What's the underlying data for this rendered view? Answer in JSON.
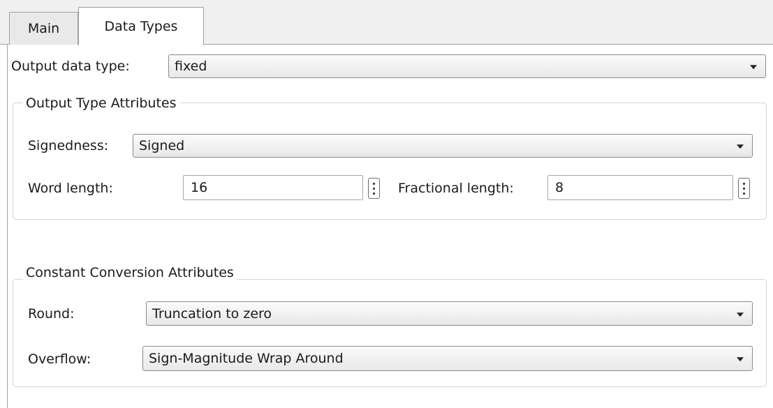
{
  "tabs": [
    {
      "label": "Main",
      "active": false
    },
    {
      "label": "Data Types",
      "active": true
    }
  ],
  "output_data_type": {
    "label": "Output data type:",
    "value": "fixed"
  },
  "output_type_attributes": {
    "title": "Output Type Attributes",
    "signedness": {
      "label": "Signedness:",
      "value": "Signed"
    },
    "word_length": {
      "label": "Word length:",
      "value": "16"
    },
    "fractional_length": {
      "label": "Fractional length:",
      "value": "8"
    }
  },
  "constant_conversion_attributes": {
    "title": "Constant Conversion Attributes",
    "round": {
      "label": "Round:",
      "value": "Truncation to zero"
    },
    "overflow": {
      "label": "Overflow:",
      "value": "Sign-Magnitude Wrap Around"
    }
  },
  "icons": {
    "dropdown_arrow": "chevron-down-icon",
    "spinner": "vertical-ellipsis-icon"
  },
  "colors": {
    "tab_active_bg": "#ffffff",
    "tab_inactive_bg": "#e9e9e9",
    "group_border": "#d4d4d4",
    "field_border": "#a9a9a9"
  }
}
